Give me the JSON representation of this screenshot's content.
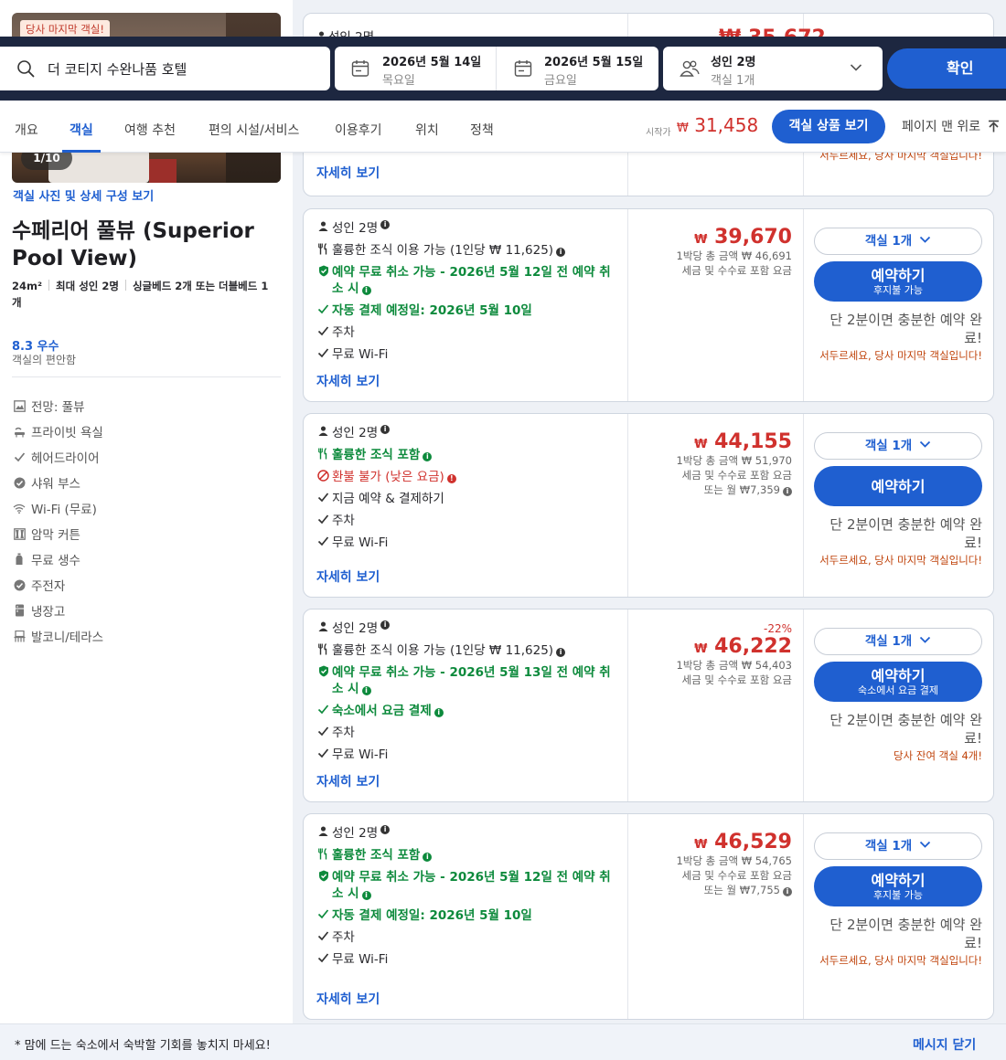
{
  "room": {
    "badge": "당사 마지막 객실!",
    "photo_counter": "1/10",
    "photos_link": "객실 사진 및 상세 구성 보기",
    "name": "수페리어 풀뷰 (Superior Pool View)",
    "size": "24m²",
    "occupancy": "최대 성인 2명",
    "beds": "싱글베드 2개 또는 더블베드 1개",
    "rating": "8.3 우수",
    "rating_note": "객실의 편안함",
    "amenities": [
      {
        "label": "전망: 풀뷰",
        "icon": "view-icon"
      },
      {
        "label": "프라이빗 욕실",
        "icon": "shower-icon"
      },
      {
        "label": "헤어드라이어",
        "icon": "check-icon"
      },
      {
        "label": "샤워 부스",
        "icon": "check-circle-icon"
      },
      {
        "label": "Wi-Fi (무료)",
        "icon": "wifi-icon"
      },
      {
        "label": "암막 커튼",
        "icon": "curtain-icon"
      },
      {
        "label": "무료 생수",
        "icon": "bottle-icon"
      },
      {
        "label": "주전자",
        "icon": "check-circle-icon"
      },
      {
        "label": "냉장고",
        "icon": "fridge-icon"
      },
      {
        "label": "발코니/테라스",
        "icon": "balcony-icon"
      }
    ]
  },
  "search": {
    "hotel": "더 코티지 수완나품 호텔",
    "checkin_date": "2026년 5월 14일",
    "checkin_day": "목요일",
    "checkout_date": "2026년 5월 15일",
    "checkout_day": "금요일",
    "guests": "성인 2명",
    "rooms": "객실 1개",
    "confirm": "확인"
  },
  "tabs": [
    "개요",
    "객실",
    "여행 추천",
    "편의 시설/서비스",
    "이용후기",
    "위치",
    "정책"
  ],
  "active_tab": "객실",
  "header_price": {
    "from_label": "시작가",
    "currency": "₩",
    "value": "31,458",
    "offers_button": "객실 상품 보기",
    "back_to_top": "페이지 맨 위로"
  },
  "top_card": {
    "guests": "성인 2명",
    "details": "자세히 보기",
    "urgent_note": "서두르세요, 당사 마지막 객실입니다!",
    "price_partial": "35,672"
  },
  "offers": [
    {
      "guests": "성인 2명",
      "features": [
        {
          "text": "훌륭한 조식 이용 가능 (1인당 ₩ 11,625)",
          "style": "normal",
          "icon": "fork-knife-icon",
          "info": "dark"
        },
        {
          "text": "예약 무료 취소 가능 - 2026년 5월 12일 전 예약 취소 시",
          "style": "green",
          "icon": "shield-icon",
          "info": "green"
        },
        {
          "text": "자동 결제 예정일: 2026년 5월 10일",
          "style": "green",
          "icon": "check-icon"
        },
        {
          "text": "주차",
          "style": "normal",
          "icon": "check-icon"
        },
        {
          "text": "무료 Wi-Fi",
          "style": "normal",
          "icon": "check-icon"
        }
      ],
      "discount": "",
      "price": "39,670",
      "total": "1박당 총 금액 ₩ 46,691",
      "tax": "세금 및 수수료 포함 요금",
      "monthly": "",
      "room_select": "객실 1개",
      "book_label": "예약하기",
      "book_sub": "후지불 가능",
      "urgent": "단 2분이면 충분한 예약 완료!",
      "urgent_small": "서두르세요, 당사 마지막 객실입니다!",
      "details": "자세히 보기"
    },
    {
      "guests": "성인 2명",
      "features": [
        {
          "text": "훌륭한 조식 포함",
          "style": "green",
          "icon": "fork-knife-icon",
          "info": "green"
        },
        {
          "text": "환불 불가 (낮은 요금)",
          "style": "red",
          "icon": "no-icon",
          "info": "red"
        },
        {
          "text": "지금 예약 & 결제하기",
          "style": "normal",
          "icon": "check-icon"
        },
        {
          "text": "주차",
          "style": "normal",
          "icon": "check-icon"
        },
        {
          "text": "무료 Wi-Fi",
          "style": "normal",
          "icon": "check-icon"
        }
      ],
      "discount": "",
      "price": "44,155",
      "total": "1박당 총 금액 ₩ 51,970",
      "tax": "세금 및 수수료 포함 요금",
      "monthly": "또는 월 ₩7,359",
      "room_select": "객실 1개",
      "book_label": "예약하기",
      "book_sub": "",
      "urgent": "단 2분이면 충분한 예약 완료!",
      "urgent_small": "서두르세요, 당사 마지막 객실입니다!",
      "details": "자세히 보기"
    },
    {
      "guests": "성인 2명",
      "features": [
        {
          "text": "훌륭한 조식 이용 가능 (1인당 ₩ 11,625)",
          "style": "normal",
          "icon": "fork-knife-icon",
          "info": "dark"
        },
        {
          "text": "예약 무료 취소 가능 - 2026년 5월 13일 전 예약 취소 시",
          "style": "green",
          "icon": "shield-icon",
          "info": "green"
        },
        {
          "text": "숙소에서 요금 결제",
          "style": "green",
          "icon": "check-icon",
          "info": "green"
        },
        {
          "text": "주차",
          "style": "normal",
          "icon": "check-icon"
        },
        {
          "text": "무료 Wi-Fi",
          "style": "normal",
          "icon": "check-icon"
        }
      ],
      "discount": "-22%",
      "price": "46,222",
      "total": "1박당 총 금액 ₩ 54,403",
      "tax": "세금 및 수수료 포함 요금",
      "monthly": "",
      "room_select": "객실 1개",
      "book_label": "예약하기",
      "book_sub": "숙소에서 요금 결제",
      "urgent": "단 2분이면 충분한 예약 완료!",
      "urgent_small": "당사 잔여 객실 4개!",
      "details": "자세히 보기"
    },
    {
      "guests": "성인 2명",
      "features": [
        {
          "text": "훌륭한 조식 포함",
          "style": "green",
          "icon": "fork-knife-icon",
          "info": "green"
        },
        {
          "text": "예약 무료 취소 가능 - 2026년 5월 12일 전 예약 취소 시",
          "style": "green",
          "icon": "shield-icon",
          "info": "green"
        },
        {
          "text": "자동 결제 예정일: 2026년 5월 10일",
          "style": "green",
          "icon": "check-icon"
        },
        {
          "text": "주차",
          "style": "normal",
          "icon": "check-icon"
        },
        {
          "text": "무료 Wi-Fi",
          "style": "normal",
          "icon": "check-icon"
        }
      ],
      "discount": "",
      "price": "46,529",
      "total": "1박당 총 금액 ₩ 54,765",
      "tax": "세금 및 수수료 포함 요금",
      "monthly": "또는 월 ₩7,755",
      "room_select": "객실 1개",
      "book_label": "예약하기",
      "book_sub": "후지불 가능",
      "urgent": "단 2분이면 충분한 예약 완료!",
      "urgent_small": "서두르세요, 당사 마지막 객실입니다!",
      "details": "자세히 보기"
    }
  ],
  "bottom_bar": {
    "message": "* 맘에 드는 숙소에서 숙박할 기회를 놓치지 마세요!",
    "close": "메시지 닫기"
  },
  "colors": {
    "accent": "#1f5fd0",
    "price_red": "#d0312d",
    "green": "#0d8a3c",
    "header_bg": "#1d2740"
  }
}
